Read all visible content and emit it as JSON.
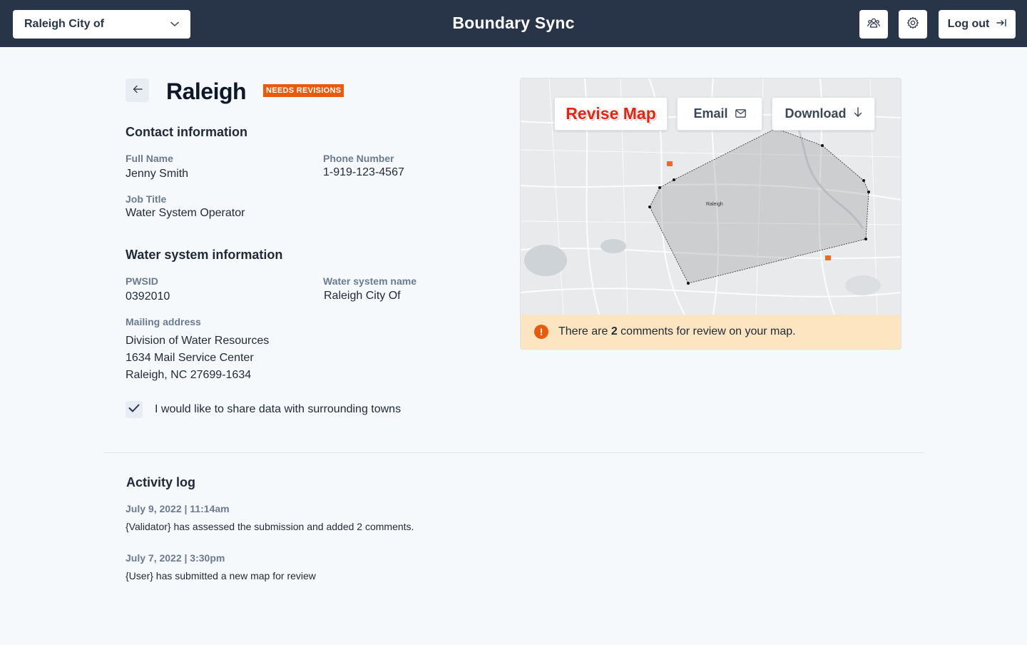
{
  "header": {
    "org_select_value": "Raleigh City of",
    "brand": "Boundary Sync",
    "users_icon": "users-icon",
    "settings_icon": "gear-icon",
    "logout_label": "Log out",
    "logout_icon": "logout-arrow-icon",
    "bg_color": "#283447"
  },
  "page": {
    "title": "Raleigh",
    "status": "NEEDS REVISIONS",
    "status_color": "#ea5a0c"
  },
  "contact": {
    "heading": "Contact information",
    "full_name_label": "Full Name",
    "full_name": "Jenny Smith",
    "phone_label": "Phone Number",
    "phone": "1-919-123-4567",
    "job_title_label": "Job Title",
    "job_title": "Water System Operator"
  },
  "water_system": {
    "heading": "Water system information",
    "pwsid_label": "PWSID",
    "pwsid": "0392010",
    "name_label": "Water system name",
    "name": "Raleigh City Of",
    "mailing_label": "Mailing address",
    "address_line1": "Division of Water Resources",
    "address_line2": "1634 Mail Service Center",
    "address_line3": "Raleigh, NC 27699-1634"
  },
  "share": {
    "checked": true,
    "label": "I would like to share data with surrounding towns"
  },
  "map": {
    "revise_label": "Revise Map",
    "email_label": "Email",
    "download_label": "Download",
    "city_label": "Raleigh",
    "alert_prefix": "There are ",
    "alert_count": "2",
    "alert_suffix": " comments for review on your map.",
    "alert_bg": "#fde5c2"
  },
  "activity": {
    "heading": "Activity log",
    "entries": [
      {
        "date": "July 9, 2022 | 11:14am",
        "text": "{Validator} has assessed the submission and added 2 comments."
      },
      {
        "date": "July 7, 2022 | 3:30pm",
        "text": "{User} has submitted a new map for review"
      }
    ]
  }
}
